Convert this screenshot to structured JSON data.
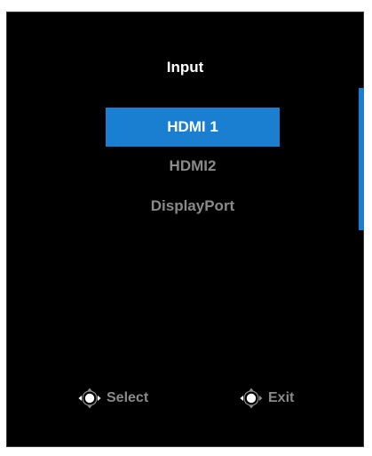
{
  "menu": {
    "title": "Input",
    "items": [
      {
        "label": "HDMI 1",
        "selected": true
      },
      {
        "label": "HDMI2",
        "selected": false
      },
      {
        "label": "DisplayPort",
        "selected": false
      }
    ]
  },
  "footer": {
    "select_label": "Select",
    "select_icon": "joystick-left-right-icon",
    "exit_label": "Exit",
    "exit_icon": "joystick-left-icon"
  },
  "colors": {
    "background": "#000000",
    "accent": "#1a7fd1",
    "selected_text": "#ffffff",
    "unselected_text": "#8a8a8a"
  }
}
